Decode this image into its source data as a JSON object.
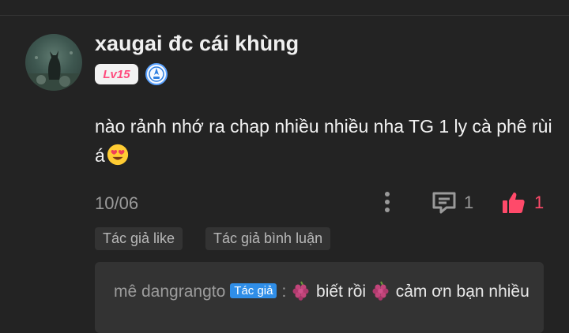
{
  "comment": {
    "username": "xaugai đc cái khùng",
    "level": "Lv15",
    "text": "nào rảnh nhớ ra chap nhiều nhiều nha TG 1 ly cà phê rùi á",
    "emoji": "heart-eyes-emoji",
    "date": "10/06",
    "reply_count": "1",
    "like_count": "1",
    "tags": [
      "Tác giả like",
      "Tác giả bình luận"
    ]
  },
  "reply": {
    "author": "mê dangrangto",
    "author_badge": "Tác giả",
    "separator": ":",
    "text_part1": "biết rồi",
    "text_part2": "cảm ơn bạn nhiều",
    "emoji": "grapes-emoji"
  },
  "colors": {
    "background": "#232323",
    "accent_pink": "#ff4a6a",
    "badge_blue": "#2f8ee8"
  }
}
